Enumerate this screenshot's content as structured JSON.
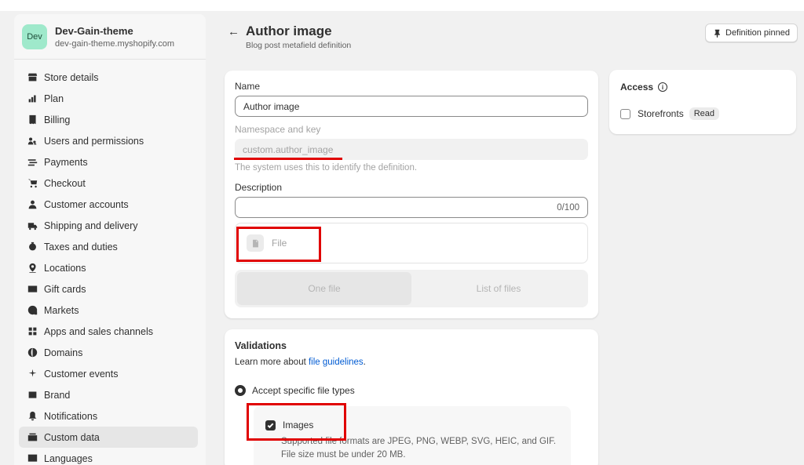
{
  "store": {
    "avatar": "Dev",
    "name": "Dev-Gain-theme",
    "url": "dev-gain-theme.myshopify.com"
  },
  "sidebar": {
    "items": [
      {
        "label": "Store details",
        "icon": "store-icon"
      },
      {
        "label": "Plan",
        "icon": "plan-icon"
      },
      {
        "label": "Billing",
        "icon": "billing-icon"
      },
      {
        "label": "Users and permissions",
        "icon": "users-icon"
      },
      {
        "label": "Payments",
        "icon": "payments-icon"
      },
      {
        "label": "Checkout",
        "icon": "cart-icon"
      },
      {
        "label": "Customer accounts",
        "icon": "person-icon"
      },
      {
        "label": "Shipping and delivery",
        "icon": "truck-icon"
      },
      {
        "label": "Taxes and duties",
        "icon": "tax-icon"
      },
      {
        "label": "Locations",
        "icon": "location-icon"
      },
      {
        "label": "Gift cards",
        "icon": "gift-card-icon"
      },
      {
        "label": "Markets",
        "icon": "markets-icon"
      },
      {
        "label": "Apps and sales channels",
        "icon": "apps-icon"
      },
      {
        "label": "Domains",
        "icon": "globe-icon"
      },
      {
        "label": "Customer events",
        "icon": "events-icon"
      },
      {
        "label": "Brand",
        "icon": "brand-icon"
      },
      {
        "label": "Notifications",
        "icon": "bell-icon"
      },
      {
        "label": "Custom data",
        "icon": "custom-data-icon",
        "active": true
      },
      {
        "label": "Languages",
        "icon": "language-icon"
      }
    ]
  },
  "header": {
    "title": "Author image",
    "subtitle": "Blog post metafield definition",
    "pin_label": "Definition pinned"
  },
  "form": {
    "name_label": "Name",
    "name_value": "Author image",
    "ns_label": "Namespace and key",
    "ns_value": "custom.author_image",
    "ns_help": "The system uses this to identify the definition.",
    "desc_label": "Description",
    "desc_counter": "0/100",
    "type_label": "File",
    "seg_one": "One file",
    "seg_list": "List of files"
  },
  "access": {
    "title": "Access",
    "storefronts_label": "Storefronts",
    "storefronts_badge": "Read"
  },
  "validations": {
    "title": "Validations",
    "learn_prefix": "Learn more about ",
    "learn_link": "file guidelines",
    "learn_suffix": ".",
    "radio_label": "Accept specific file types",
    "images_label": "Images",
    "images_help": "Supported file formats are JPEG, PNG, WEBP, SVG, HEIC, and GIF. File size must be under 20 MB."
  },
  "colors": {
    "highlight": "#e00000",
    "link": "#005bd3",
    "avatar": "#9fe9cb"
  }
}
